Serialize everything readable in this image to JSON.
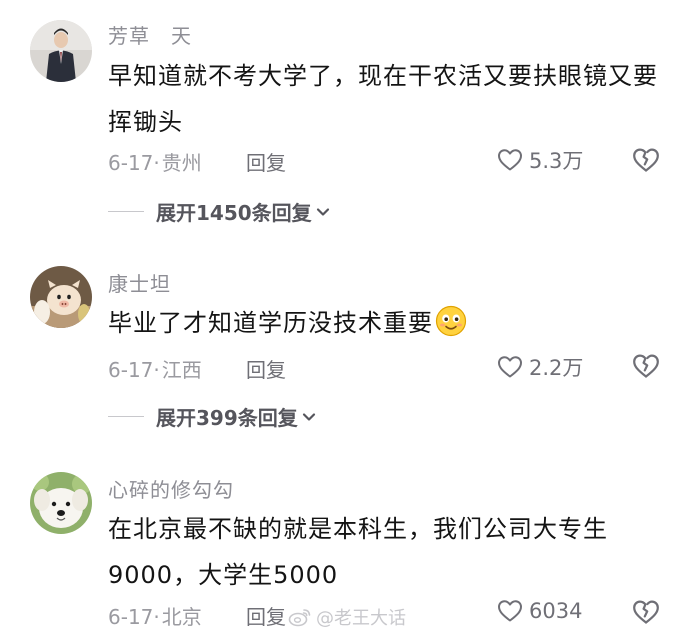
{
  "comments": [
    {
      "username": "芳草　天",
      "text": "早知道就不考大学了，现在干农活又要扶眼镜又要挥锄头",
      "date": "6-17",
      "separator": "·",
      "location": "贵州",
      "reply_label": "回复",
      "likes": "5.3万",
      "expand_label": "展开1450条回复",
      "avatar_icon": "person-in-suit-avatar"
    },
    {
      "username": "康士坦",
      "text": "毕业了才知道学历没技术重要",
      "emoji_icon": "smiling-face-emoji-icon",
      "date": "6-17",
      "separator": "·",
      "location": "江西",
      "reply_label": "回复",
      "likes": "2.2万",
      "expand_label": "展开399条回复",
      "avatar_icon": "cartoon-pig-avatar"
    },
    {
      "username": "心碎的修勾勾",
      "text": "在北京最不缺的就是本科生，我们公司大专生9000，大学生5000",
      "date": "6-17",
      "separator": "·",
      "location": "北京",
      "reply_label": "回复",
      "likes": "6034",
      "avatar_icon": "white-dog-avatar"
    }
  ],
  "watermark": {
    "text": "@老王大话",
    "icon": "weibo-logo-icon"
  },
  "colors": {
    "username": "#8e8e95",
    "body_text": "#141414",
    "meta": "#9a9aa0",
    "icon_stroke": "#6f6f76"
  }
}
